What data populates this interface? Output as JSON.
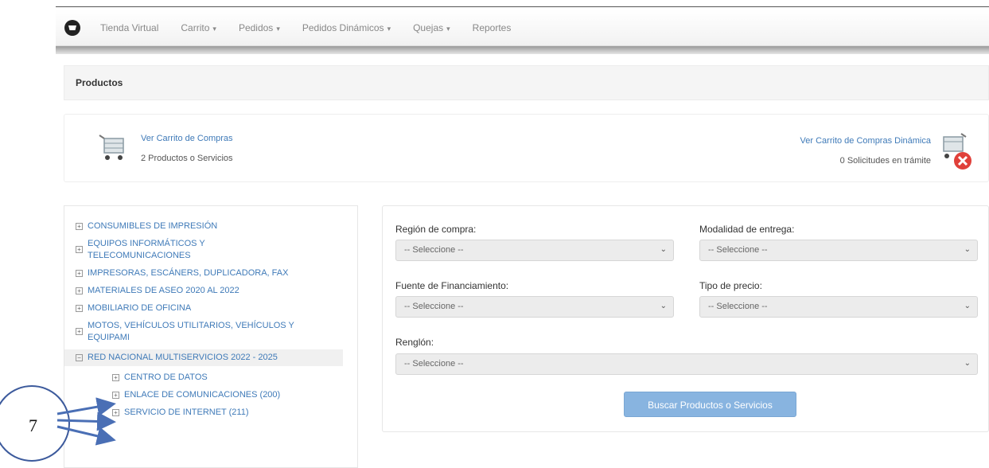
{
  "nav": {
    "items": [
      {
        "label": "Tienda Virtual",
        "caret": ""
      },
      {
        "label": "Carrito",
        "caret": "▾"
      },
      {
        "label": "Pedidos",
        "caret": "▾"
      },
      {
        "label": "Pedidos Dinámicos",
        "caret": "▾"
      },
      {
        "label": "Quejas",
        "caret": "▾"
      },
      {
        "label": "Reportes",
        "caret": ""
      }
    ]
  },
  "breadcrumb": {
    "title": "Productos"
  },
  "carts": {
    "left": {
      "link": "Ver Carrito de Compras",
      "sub": "2 Productos o Servicios"
    },
    "right": {
      "link": "Ver Carrito de Compras Dinámica",
      "sub": "0 Solicitudes en trámite"
    }
  },
  "categories": [
    {
      "label": "CONSUMIBLES DE IMPRESIÓN"
    },
    {
      "label": "EQUIPOS INFORMÁTICOS Y TELECOMUNICACIONES"
    },
    {
      "label": "IMPRESORAS, ESCÁNERS, DUPLICADORA, FAX"
    },
    {
      "label": "MATERIALES DE ASEO 2020 AL 2022"
    },
    {
      "label": "MOBILIARIO DE OFICINA"
    },
    {
      "label": "MOTOS, VEHÍCULOS UTILITARIOS, VEHÍCULOS Y EQUIPAMI"
    },
    {
      "label": "RED NACIONAL MULTISERVICIOS 2022 - 2025"
    },
    {
      "label": "CENTRO DE DATOS"
    },
    {
      "label": "ENLACE DE COMUNICACIONES (200)"
    },
    {
      "label": "SERVICIO DE INTERNET (211)"
    }
  ],
  "filters": {
    "region": {
      "label": "Región de compra:",
      "value": "-- Seleccione --"
    },
    "modalidad": {
      "label": "Modalidad de entrega:",
      "value": "-- Seleccione --"
    },
    "fuente": {
      "label": "Fuente de Financiamiento:",
      "value": "-- Seleccione --"
    },
    "precio": {
      "label": "Tipo de precio:",
      "value": "-- Seleccione --"
    },
    "renglon": {
      "label": "Renglón:",
      "value": "-- Seleccione --"
    },
    "search_button": "Buscar Productos o Servicios"
  },
  "annotation": {
    "number": "7"
  },
  "colors": {
    "link": "#3f7ab8",
    "button": "#88b4e0",
    "annotation": "#3c5a9c",
    "cancel": "#e0403a"
  }
}
